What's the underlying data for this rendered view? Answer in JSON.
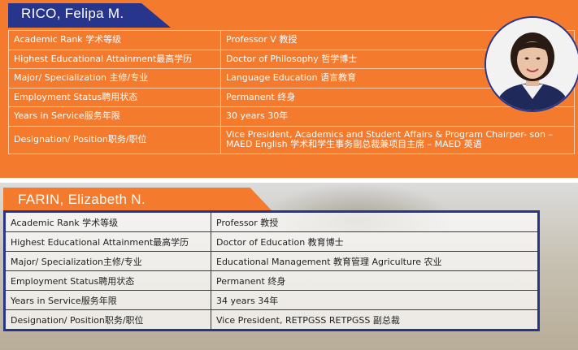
{
  "card1": {
    "name": "RICO, Felipa M.",
    "accent_color": "#f47a2e",
    "tab_color": "#28358c",
    "rows": [
      {
        "label": "Academic Rank 学术等级",
        "value": "Professor V 教授"
      },
      {
        "label": "Highest Educational Attainment最高学历",
        "value": "Doctor of Philosophy 哲学博士"
      },
      {
        "label": "Major/ Specialization 主修/专业",
        "value": "Language Education 语言教育"
      },
      {
        "label": "Employment Status聘用状态",
        "value": "Permanent 终身"
      },
      {
        "label": "Years in Service服务年限",
        "value": "30 years 30年"
      },
      {
        "label": "Designation/ Position职务/职位",
        "value": "Vice President, Academics and Student Affairs & Program Chairper- son – MAED English 学术和学生事务副总裁兼项目主席 – MAED 英语"
      }
    ]
  },
  "card2": {
    "name": "FARIN, Elizabeth N.",
    "tab_color": "#f47a2e",
    "border_color": "#28358c",
    "rows": [
      {
        "label": "Academic Rank 学术等级",
        "value": "Professor 教授"
      },
      {
        "label": "Highest Educational Attainment最高学历",
        "value": "Doctor of Education 教育博士"
      },
      {
        "label": "Major/ Specialization主修/专业",
        "value": "Educational Management 教育管理 Agriculture 农业"
      },
      {
        "label": "Employment Status聘用状态",
        "value": "Permanent 终身"
      },
      {
        "label": "Years in Service服务年限",
        "value": "34 years 34年"
      },
      {
        "label": "Designation/ Position职务/职位",
        "value": "Vice President, RETPGSS RETPGSS 副总裁"
      }
    ]
  }
}
